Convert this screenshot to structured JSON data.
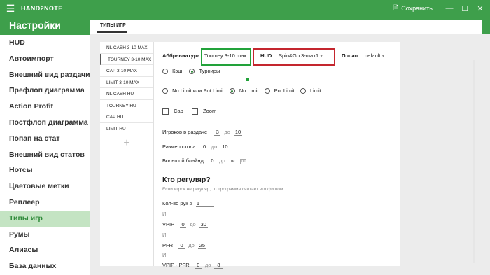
{
  "titlebar": {
    "menu_icon": "hamburger-icon",
    "app_name": "HAND2NOTE",
    "save_label": "Сохранить",
    "save_icon": "save-icon",
    "minimize": "—",
    "maximize": "☐",
    "close": "✕"
  },
  "sidebar": {
    "title": "Настройки",
    "items": [
      {
        "label": "HUD"
      },
      {
        "label": "Автоимпорт"
      },
      {
        "label": "Внешний вид раздачи"
      },
      {
        "label": "Префлоп диаграмма"
      },
      {
        "label": "Action Profit"
      },
      {
        "label": "Постфлоп диаграмма"
      },
      {
        "label": "Попап на стат"
      },
      {
        "label": "Внешний вид статов"
      },
      {
        "label": "Нотсы"
      },
      {
        "label": "Цветовые метки"
      },
      {
        "label": "Реплеер"
      },
      {
        "label": "Типы игр",
        "active": true
      },
      {
        "label": "Румы"
      },
      {
        "label": "Алиасы"
      },
      {
        "label": "База данных"
      }
    ]
  },
  "tabs": {
    "active": "ТИПЫ ИГР"
  },
  "game_types": {
    "items": [
      "NL CASH 3-10 MAX",
      "TOURNEY 3-10 MAX",
      "CAP 3-10 MAX",
      "LIMIT 3-10 MAX",
      "NL CASH HU",
      "TOURNEY HU",
      "CAP HU",
      "LIMIT HU"
    ],
    "active_index": 1,
    "add_label": "+"
  },
  "form": {
    "abbr_label": "Аббревиатура",
    "abbr_value": "Tourney 3-10 max",
    "hud_label": "HUD",
    "hud_value": "Spin&Go 3-max1",
    "popup_label": "Попап",
    "popup_value": "default",
    "game_cash": "Кэш",
    "game_tourney": "Турниры",
    "limit_nl_pl": "No Limit или Pot Limit",
    "limit_nl": "No Limit",
    "limit_pl": "Pot Limit",
    "limit_l": "Limit",
    "cap_label": "Cap",
    "zoom_label": "Zoom",
    "players_label": "Игроков в раздаче",
    "players_from": "3",
    "players_to": "10",
    "table_label": "Размер стола",
    "table_from": "0",
    "table_to": "10",
    "bigblind_label": "Большой блайнд",
    "bigblind_from": "0",
    "bigblind_to": "∞",
    "bigblind_extra": "00",
    "do": "до",
    "reg_title": "Кто регуляр?",
    "reg_desc": "Если игрок не регуляр, то программа считает его фишом",
    "hands_label": "Кол-во рук ≥",
    "hands_value": "1",
    "and": "И",
    "vpip_label": "VPIP",
    "vpip_from": "0",
    "vpip_to": "30",
    "pfr_label": "PFR",
    "pfr_from": "0",
    "pfr_to": "25",
    "vpip_pfr_label": "VPIP - PFR",
    "vpip_pfr_from": "0",
    "vpip_pfr_to": "8"
  },
  "colors": {
    "accent": "#3e9f4b",
    "highlight_green": "#22a23a",
    "highlight_red": "#c4262e",
    "active_bg": "#c4e4c3"
  }
}
